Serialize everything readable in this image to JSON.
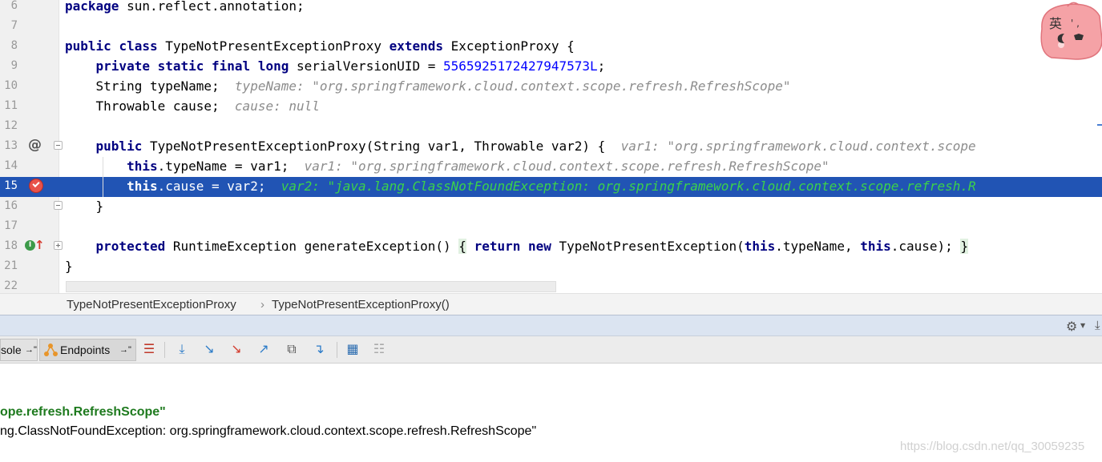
{
  "editor": {
    "lines": [
      {
        "num": "6",
        "id": "line-6"
      },
      {
        "num": "7",
        "id": "line-7"
      },
      {
        "num": "8",
        "id": "line-8"
      },
      {
        "num": "9",
        "id": "line-9"
      },
      {
        "num": "10",
        "id": "line-10"
      },
      {
        "num": "11",
        "id": "line-11"
      },
      {
        "num": "12",
        "id": "line-12"
      },
      {
        "num": "13",
        "id": "line-13"
      },
      {
        "num": "14",
        "id": "line-14"
      },
      {
        "num": "15",
        "id": "line-15"
      },
      {
        "num": "16",
        "id": "line-16"
      },
      {
        "num": "17",
        "id": "line-17"
      },
      {
        "num": "18",
        "id": "line-18"
      },
      {
        "num": "21",
        "id": "line-21"
      },
      {
        "num": "22",
        "id": "line-22"
      }
    ],
    "tokens": {
      "l6_kw": "package",
      "l6_rest": " sun.reflect.annotation;",
      "l8_kw1": "public",
      "l8_kw2": "class",
      "l8_name": " TypeNotPresentExceptionProxy ",
      "l8_kw3": "extends",
      "l8_rest": " ExceptionProxy {",
      "l9_kw": "private static final long",
      "l9_name": " serialVersionUID = ",
      "l9_num": "5565925172427947573L",
      "l9_end": ";",
      "l10_code": "String typeName;  ",
      "l10_hint": "typeName: \"org.springframework.cloud.context.scope.refresh.RefreshScope\"",
      "l11_code": "Throwable cause;  ",
      "l11_hint": "cause: null",
      "l13_kw": "public",
      "l13_code": " TypeNotPresentExceptionProxy(String var1, Throwable var2) {  ",
      "l13_hint": "var1: \"org.springframework.cloud.context.scope",
      "l14_kw": "this",
      "l14_code": ".typeName = var1;  ",
      "l14_hint": "var1: \"org.springframework.cloud.context.scope.refresh.RefreshScope\"",
      "l15_kw": "this",
      "l15_code": ".cause = var2;  ",
      "l15_hint": "var2: \"java.lang.ClassNotFoundException: org.springframework.cloud.context.scope.refresh.R",
      "l16_code": "}",
      "l18_kw": "protected",
      "l18_code1": " RuntimeException generateException() ",
      "l18_brace_open": "{",
      "l18_kw2": "return new",
      "l18_code2": " TypeNotPresentException(",
      "l18_kw3": "this",
      "l18_code3": ".typeName, ",
      "l18_kw4": "this",
      "l18_code4": ".cause); ",
      "l18_brace_close": "}",
      "l21_code": "}"
    },
    "gutter": {
      "at_symbol": "@",
      "implement_badge": "I"
    },
    "mascot_char": "英",
    "mascot_dots": "' ,"
  },
  "breadcrumb": {
    "items": [
      "TypeNotPresentExceptionProxy",
      "TypeNotPresentExceptionProxy()"
    ],
    "separator": "›"
  },
  "debug_panel": {
    "tabs": [
      {
        "label": "sole",
        "suffix": "→\""
      },
      {
        "label": "Endpoints",
        "suffix": "→\""
      }
    ],
    "toolbar_icons": [
      "show-execution-point-icon",
      "step-over-icon",
      "step-into-icon",
      "force-step-into-icon",
      "step-out-icon",
      "drop-frame-icon",
      "run-to-cursor-icon",
      "evaluate-expression-icon",
      "trace-current-stream-icon"
    ]
  },
  "variables": {
    "line1": "ope.refresh.RefreshScope\"",
    "line2": "ng.ClassNotFoundException: org.springframework.cloud.context.scope.refresh.RefreshScope\""
  },
  "watermark": "https://blog.csdn.net/qq_30059235",
  "colors": {
    "selection": "#2154b4",
    "keyword": "#000080",
    "number": "#0000ff",
    "hint": "#8c8c8c",
    "selected_hint": "#3cd24a",
    "breakpoint": "#e8524a"
  }
}
